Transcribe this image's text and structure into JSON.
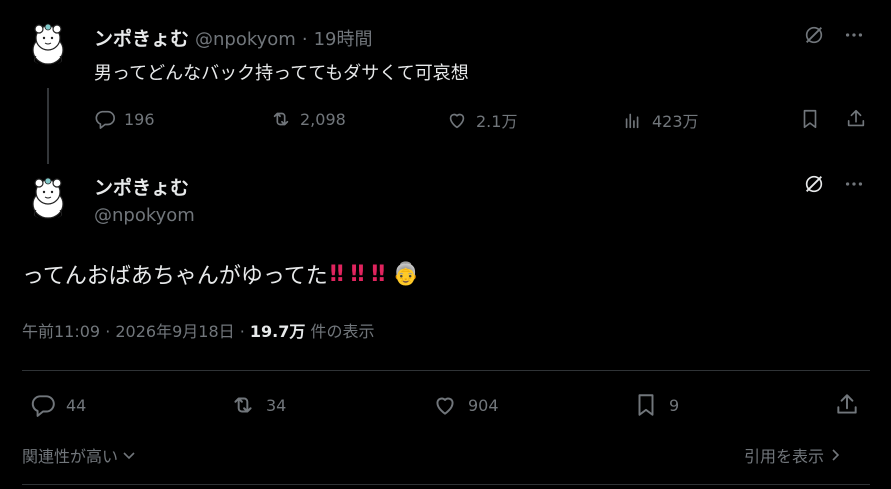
{
  "parent_tweet": {
    "display_name": "ンポきょむ",
    "handle": "@npokyom",
    "separator": "·",
    "time": "19時間",
    "text": "男ってどんなバック持っててもダサくて可哀想",
    "stats": {
      "replies": "196",
      "retweets": "2,098",
      "likes": "2.1万",
      "views": "423万"
    }
  },
  "main_tweet": {
    "display_name": "ンポきょむ",
    "handle": "@npokyom",
    "text": "ってんおばあちゃんがゆってた",
    "bangs": [
      "‼",
      "‼",
      "‼"
    ],
    "emoji": "👵",
    "timestamp": "午前11:09 · 2026年9月18日 · ",
    "views_count": "19.7万",
    "views_label": " 件の表示",
    "stats": {
      "replies": "44",
      "retweets": "34",
      "likes": "904",
      "bookmarks": "9"
    }
  },
  "footer": {
    "sort_label": "関連性が高い",
    "quotes_label": "引用を表示"
  },
  "icons": {
    "grok": "grok-icon",
    "more": "more-icon",
    "reply": "reply-icon",
    "retweet": "retweet-icon",
    "like": "heart-icon",
    "views": "analytics-icon",
    "bookmark": "bookmark-icon",
    "share": "share-icon"
  },
  "colors": {
    "background": "#000000",
    "text": "#e7e9ea",
    "muted": "#71767b",
    "divider": "#2f3336",
    "bang": "#e0245e"
  }
}
